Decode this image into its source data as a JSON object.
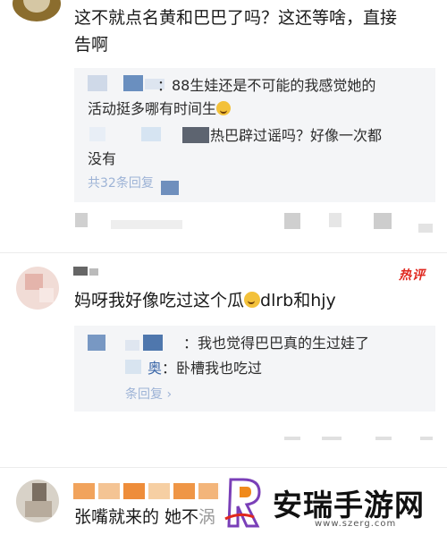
{
  "comments": [
    {
      "text_line1": "这不就点名黄和巴巴了吗？这还等啥，直接",
      "text_line2": "告啊",
      "replies": [
        {
          "line1": "：88生娃还是不可能的我感觉她的",
          "line2": "活动挺多哪有时间生"
        },
        {
          "line1": "热巴辟过谣吗？好像一次都",
          "line2": "没有"
        }
      ],
      "more_replies": "共32条回复"
    },
    {
      "badge": "热评",
      "text": "妈呀我好像吃过这个瓜",
      "text_suffix": "dlrb和hjy",
      "replies": [
        {
          "line1": "：我也觉得巴巴真的生过娃了"
        },
        {
          "line1": "：卧槽我也吃过"
        }
      ],
      "more_replies": "条回复"
    },
    {
      "text": "张嘴就来的 她不",
      "text_tail": "涡"
    }
  ],
  "watermark": {
    "name": "安瑞手游网",
    "url": "www.szerg.com"
  },
  "colors": {
    "hot_badge": "#e0281f",
    "reply_bg": "#f4f5f7",
    "link": "#3a66a8"
  }
}
